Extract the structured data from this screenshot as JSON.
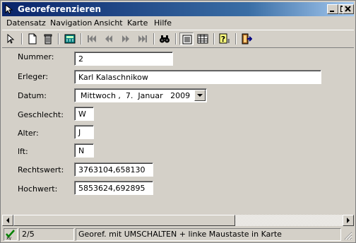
{
  "window": {
    "title": "Georeferenzieren"
  },
  "menu": [
    "Datensatz",
    "Navigation",
    "Ansicht",
    "Karte",
    "Hilfe"
  ],
  "icons": {
    "toolbar": [
      "arrow-pointer-icon",
      "new-document-icon",
      "trash-icon",
      "calculator-icon",
      "first-record-icon",
      "previous-page-icon",
      "next-page-icon",
      "last-record-icon",
      "binoculars-icon",
      "form-view-icon",
      "table-view-icon",
      "help-icon",
      "exit-icon"
    ]
  },
  "form": {
    "nummer": {
      "label": "Nummer:",
      "value": "2"
    },
    "erleger": {
      "label": "Erleger:",
      "value": "Karl Kalaschnikow"
    },
    "datum": {
      "label": "Datum:",
      "weekday": "Mittwoch",
      "sep": ",",
      "day": "7.",
      "month": "Januar",
      "year": "2009"
    },
    "geschlecht": {
      "label": "Geschlecht:",
      "value": "W"
    },
    "alter": {
      "label": "Alter:",
      "value": "J"
    },
    "lft": {
      "label": "lft:",
      "value": "N"
    },
    "rechtswert": {
      "label": "Rechtswert:",
      "value": "3763104,658130"
    },
    "hochwert": {
      "label": "Hochwert:",
      "value": "5853624,692895"
    }
  },
  "status": {
    "indicator": "xy",
    "record": "2/5",
    "hint": "Georef. mit UMSCHALTEN + linke Maustaste in Karte"
  },
  "colors": {
    "titlebar": "#0a246a",
    "face": "#d4d0c8"
  }
}
